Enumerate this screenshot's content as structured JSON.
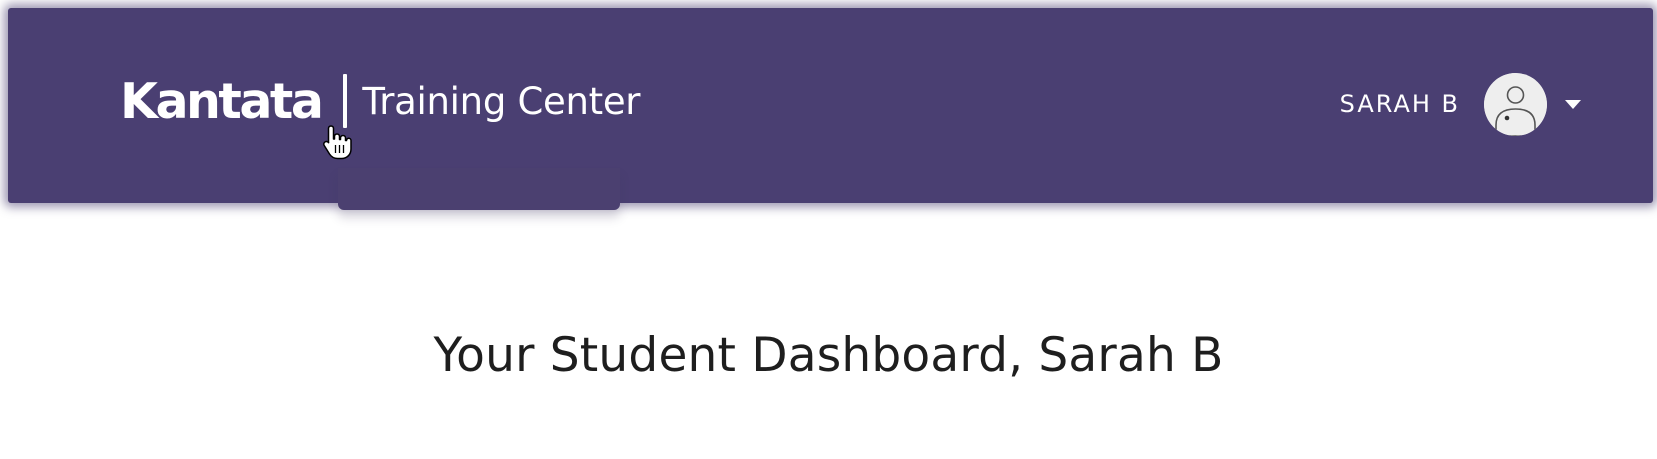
{
  "header": {
    "brand": {
      "logo_text": "Kantata",
      "subtitle": "Training Center"
    },
    "user": {
      "name": "SARAH B",
      "avatar_icon": "user-avatar-icon",
      "menu_icon": "caret-down-icon"
    },
    "background_color": "#4a3f72"
  },
  "main": {
    "title": "Your Student Dashboard, Sarah B"
  },
  "cursor": {
    "icon": "hand-pointer-icon"
  }
}
